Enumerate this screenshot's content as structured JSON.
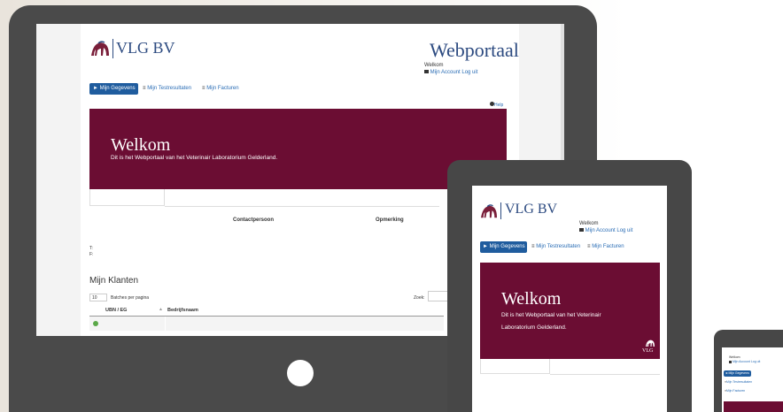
{
  "brand": {
    "name": "VLG BV",
    "mark": "VLG"
  },
  "portal_title": "Webportaal",
  "user": {
    "welcome": "Welkom",
    "account": "Mijn Account",
    "logout": "Log uit"
  },
  "nav": {
    "gegevens": "Mijn Gegevens",
    "testresultaten": "Mijn Testresultaten",
    "facturen": "Mijn Facturen"
  },
  "help": "Help",
  "hero": {
    "title": "Welkom",
    "text": "Dit is het Webportaal van het Veterinair Laboratorium Gelderland.",
    "text_line1": "Dit is het Webportaal van het Veterinair",
    "text_line2": "Laboratorium Gelderland."
  },
  "contact": {
    "col1": "Contactpersoon",
    "col2": "Opmerking",
    "t_label": "T:",
    "f_label": "F:"
  },
  "klanten": {
    "title": "Mijn Klanten",
    "page_size": "10",
    "per_page_label": "Batches per pagina",
    "search_label": "Zoek:",
    "columns": [
      "UBN / EG",
      "Bedrijfsnaam"
    ]
  },
  "colors": {
    "brand_blue": "#2c4a80",
    "hero": "#6b0d33",
    "nav_button": "#1f5c9e",
    "device": "#4a4a4a"
  }
}
